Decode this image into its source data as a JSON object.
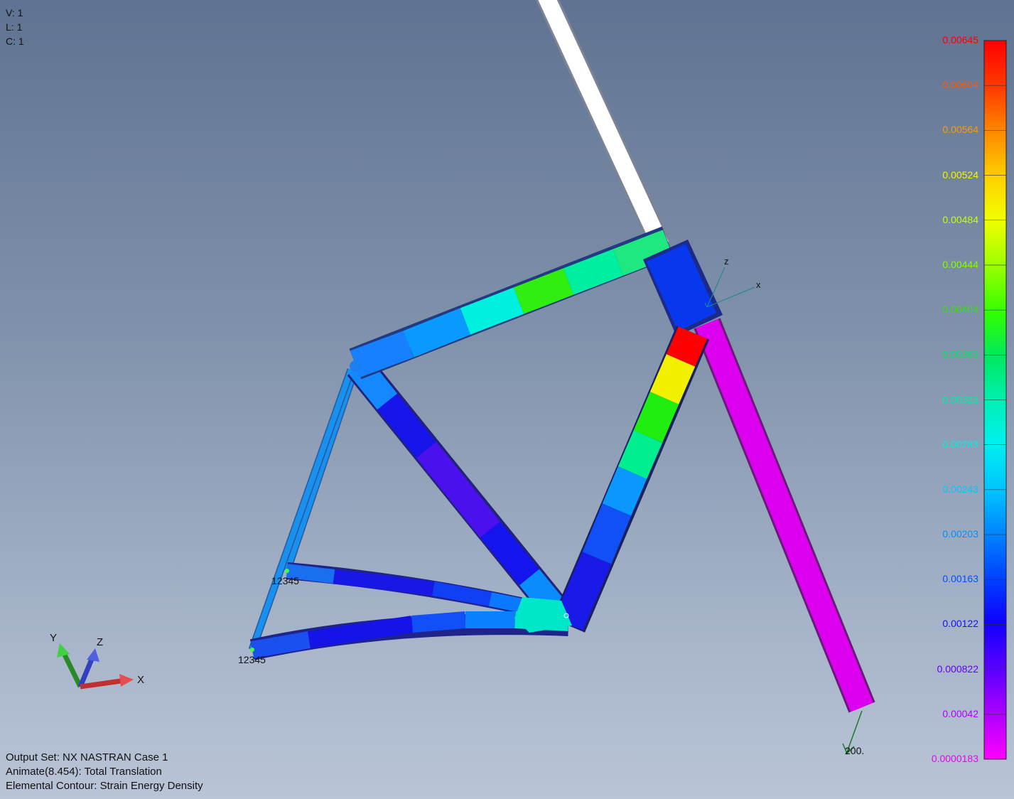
{
  "view_info": {
    "view": "V: 1",
    "layer": "L: 1",
    "color": "C: 1"
  },
  "output_info": {
    "output_set": "Output Set: NX NASTRAN Case 1",
    "animate": "Animate(8.454): Total Translation",
    "contour": "Elemental Contour: Strain Energy Density"
  },
  "legend": {
    "labels": [
      {
        "text": "0.00645",
        "color": "#ff0000"
      },
      {
        "text": "0.00604",
        "color": "#ff5a00"
      },
      {
        "text": "0.00564",
        "color": "#ff9a00"
      },
      {
        "text": "0.00524",
        "color": "#f5f500"
      },
      {
        "text": "0.00484",
        "color": "#c8ff00"
      },
      {
        "text": "0.00444",
        "color": "#80ff00"
      },
      {
        "text": "0.00404",
        "color": "#2fe800"
      },
      {
        "text": "0.00363",
        "color": "#00e65a"
      },
      {
        "text": "0.00323",
        "color": "#00f0a0"
      },
      {
        "text": "0.00283",
        "color": "#00f0e0"
      },
      {
        "text": "0.00243",
        "color": "#00c8ff"
      },
      {
        "text": "0.00203",
        "color": "#0090ff"
      },
      {
        "text": "0.00163",
        "color": "#0050ff"
      },
      {
        "text": "0.00122",
        "color": "#1010ff"
      },
      {
        "text": "0.000822",
        "color": "#6000ff"
      },
      {
        "text": "0.00042",
        "color": "#b000ff"
      },
      {
        "text": "0.0000183",
        "color": "#ee00ee"
      }
    ]
  },
  "node_labels": {
    "upper_constraint": "12345",
    "lower_constraint": "12345",
    "load_value": "200."
  },
  "triad": {
    "x": "X",
    "y": "Y",
    "z": "Z"
  },
  "local_csys": {
    "x": "x",
    "z": "z"
  },
  "colors": {
    "handlebar_stem": "#ffffff",
    "fork": "#dd00ee",
    "head_block": "#0838ee"
  }
}
